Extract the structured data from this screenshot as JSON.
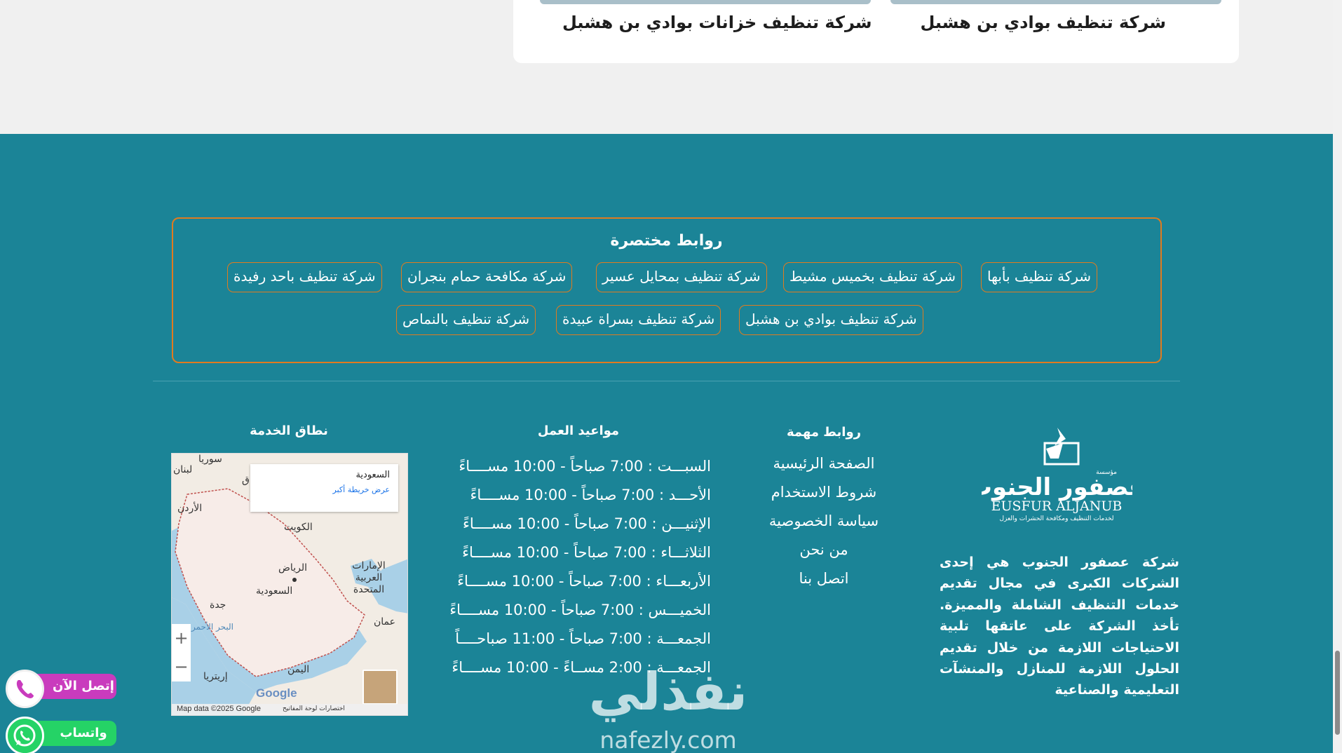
{
  "cards": [
    {
      "title": "شركة تنظيف خزانات بوادي بن هشبل"
    },
    {
      "title": "شركة تنظيف بوادي بن هشبل"
    }
  ],
  "quick_links": {
    "title": "روابط مختصرة",
    "items": [
      "شركة تنظيف بأبها",
      "شركة تنظيف بخميس مشيط",
      "شركة تنظيف بمحايل عسير",
      "شركة مكافحة حمام بنجران",
      "شركة تنظيف باحد رفيدة",
      "شركة تنظيف بوادي بن هشبل",
      "شركة تنظيف بسراة عبيدة",
      "شركة تنظيف بالنماص"
    ]
  },
  "important_links": {
    "title": "روابط مهمة",
    "items": [
      "الصفحة الرئيسية",
      "شروط الاستخدام",
      "سياسة الخصوصية",
      "من نحن",
      "اتصل بنا"
    ]
  },
  "hours": {
    "title": "مواعيد العمل",
    "rows": [
      "السبـــت : 7:00 صباحاً - 10:00 مســــاءً",
      "الأحـــد : 7:00 صباحاً - 10:00 مســــاءً",
      "الإثنيـــن : 7:00 صباحاً - 10:00 مســــاءً",
      "الثلاثـــاء : 7:00 صباحاً - 10:00 مســــاءً",
      "الأربعـــاء : 7:00 صباحاً - 10:00 مســــاءً",
      "الخميـــس : 7:00 صباحاً - 10:00 مســــاءً",
      "الجمعـــة : 7:00 صباحاً - 11:00 صباحــــاً",
      "الجمعـــة : 2:00 مســاءً - 10:00 مســــاءً"
    ]
  },
  "service_area": {
    "title": "نطاق الخدمة",
    "map_info_title": "السعودية",
    "map_info_link": "عرض خريطة أكبر",
    "map_data": "Map data ©2025 Google",
    "map_keys": "اختصارات لوحة المفاتيح",
    "google": "Google",
    "labels": {
      "syria": "سوريا",
      "lebanon": "لبنان",
      "jordan": "الأردن",
      "kuwait": "الكويت",
      "riyadh": "الرياض",
      "saudi": "السعودية",
      "uae": "الإمارات العربية المتحدة",
      "oman": "عمان",
      "jeddah": "جدة",
      "redsea": "البحر الأحمر",
      "eritrea": "إريتريا",
      "yemen": "اليمن",
      "iraq": "ق"
    }
  },
  "brand": {
    "logo_ar": "عصفور الجنوب",
    "logo_prefix": "مؤسسة",
    "logo_en": "EUSFUR ALJANUB",
    "logo_tagline": "لخدمات التنظيف ومكافحة الحشرات والعزل",
    "about": "شركة عصفور الجنوب هي إحدى الشركات الكبرى في مجال تقديم خدمات التنظيف الشاملة والمميزة. تأخذ الشركة على عاتقها تلبية الاحتياجات اللازمة من خلال تقديم الحلول اللازمة للمنازل والمنشآت التعليمية والصناعية"
  },
  "watermark": {
    "ar": "نفذلي",
    "en": "nafezly.com"
  },
  "floating": {
    "call": "إتصل الآن",
    "whatsapp": "واتساب"
  },
  "colors": {
    "footer_bg": "#1b8497",
    "accent": "#e07b1f",
    "call": "#c93bbd",
    "whatsapp": "#25d366"
  }
}
